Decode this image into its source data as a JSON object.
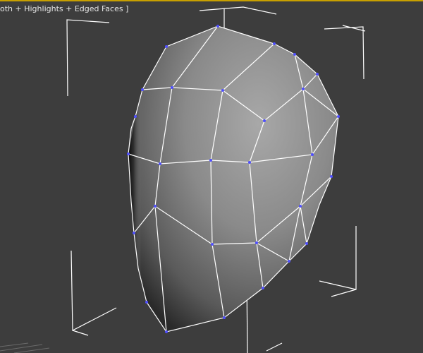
{
  "viewport": {
    "label": "oth + Highlights + Edged Faces ]",
    "render_mode": "Smooth + Highlights + Edged Faces",
    "colors": {
      "background": "#3d3d3d",
      "active_border": "#c8a000",
      "bracket": "#ffffff",
      "edge": "#ffffff",
      "vertex": "#5050ff",
      "grid": "#6a6a6a"
    }
  }
}
